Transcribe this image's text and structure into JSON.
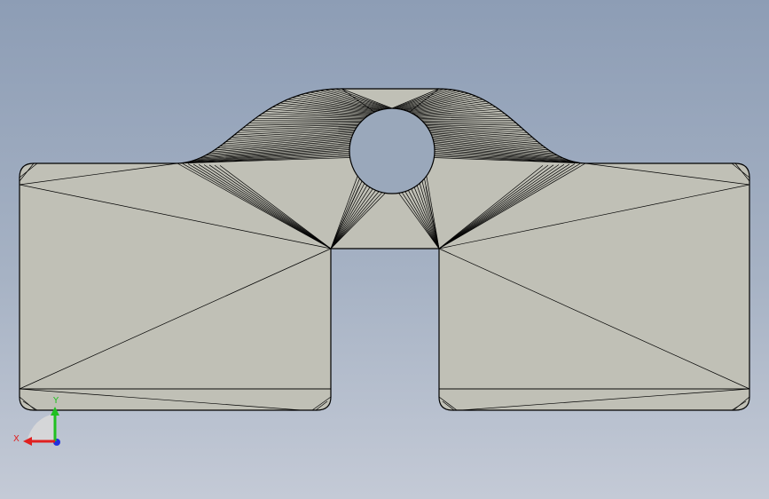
{
  "viewport": {
    "background_top": "#8d9db5",
    "background_bottom": "#c4cad6"
  },
  "model": {
    "face_color": "#c0c0b6",
    "edge_color": "#000000",
    "hole_color": "#9aa8bb"
  },
  "triad": {
    "x_label": "X",
    "y_label": "Y",
    "x_color": "#e02020",
    "y_color": "#20c020",
    "z_color": "#2030e0",
    "plane_color": "#d8d8d8"
  }
}
